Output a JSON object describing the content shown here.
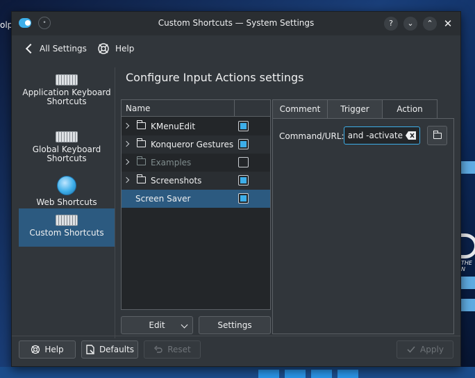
{
  "desktop": {
    "partial_text": "olp",
    "logo_text": "THE N"
  },
  "window": {
    "title": "Custom Shortcuts — System Settings",
    "controls": {
      "help": "?",
      "minimize": "⌄",
      "maximize": "⌃",
      "close": "✕"
    }
  },
  "toolbar": {
    "back_label": "All Settings",
    "help_label": "Help"
  },
  "sidebar": {
    "items": [
      {
        "label": "Application Keyboard Shortcuts",
        "icon": "keyboard-icon"
      },
      {
        "label": "Global Keyboard Shortcuts",
        "icon": "keyboard-icon"
      },
      {
        "label": "Web Shortcuts",
        "icon": "globe-icon"
      },
      {
        "label": "Custom Shortcuts",
        "icon": "keyboard-icon",
        "active": true
      }
    ]
  },
  "main": {
    "title": "Configure Input Actions settings",
    "tree": {
      "header": "Name",
      "rows": [
        {
          "name": "KMenuEdit",
          "checked": true
        },
        {
          "name": "Konqueror Gestures",
          "checked": true
        },
        {
          "name": "Examples",
          "checked": false,
          "disabled": true
        },
        {
          "name": "Screenshots",
          "checked": true
        },
        {
          "name": "Screen Saver",
          "checked": true,
          "selected": true
        }
      ]
    },
    "edit_label": "Edit",
    "settings_label": "Settings",
    "tabs": [
      "Comment",
      "Trigger",
      "Action"
    ],
    "active_tab": "Action",
    "command": {
      "label": "Command/URL:",
      "value": "nand -activate"
    }
  },
  "footer": {
    "help": "Help",
    "defaults": "Defaults",
    "reset": "Reset",
    "apply": "Apply"
  },
  "colors": {
    "accent": "#3daee9",
    "selection": "#2c5a80",
    "window_bg": "#31363b",
    "view_bg": "#232629"
  }
}
